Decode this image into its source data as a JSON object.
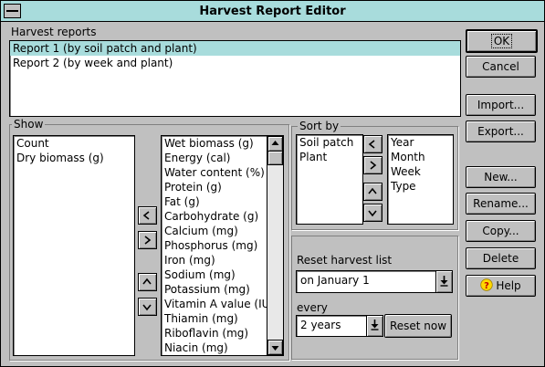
{
  "window": {
    "title": "Harvest Report Editor"
  },
  "reports": {
    "label": "Harvest reports",
    "items": [
      "Report 1 (by soil patch and plant)",
      "Report 2 (by week and plant)"
    ],
    "selected": "Report 1 (by soil patch and plant)"
  },
  "show": {
    "label": "Show",
    "selected_items": [
      "Count",
      "Dry biomass (g)"
    ],
    "available_items": [
      "Wet biomass (g)",
      "Energy (cal)",
      "Water content (%)",
      "Protein (g)",
      "Fat (g)",
      "Carbohydrate (g)",
      "Calcium (mg)",
      "Phosphorus (mg)",
      "Iron (mg)",
      "Sodium (mg)",
      "Potassium (mg)",
      "Vitamin A value (IU)",
      "Thiamin (mg)",
      "Riboflavin (mg)",
      "Niacin (mg)"
    ]
  },
  "sort": {
    "label": "Sort by",
    "selected_items": [
      "Soil patch",
      "Plant"
    ],
    "available_items": [
      "Year",
      "Month",
      "Week",
      "Type"
    ]
  },
  "reset": {
    "label": "Reset harvest list",
    "date_value": "on January 1",
    "every_label": "every",
    "every_value": "2 years",
    "reset_now_label": "Reset now"
  },
  "buttons": {
    "ok": "OK",
    "cancel": "Cancel",
    "import": "Import...",
    "export": "Export...",
    "new": "New...",
    "rename": "Rename...",
    "copy": "Copy...",
    "delete": "Delete",
    "help": "Help"
  },
  "icons": {
    "left": "chevron-left-icon",
    "right": "chevron-right-icon",
    "up": "chevron-up-icon",
    "down": "chevron-down-icon",
    "help": "question-icon",
    "dropdown": "dropdown-arrow-icon"
  }
}
